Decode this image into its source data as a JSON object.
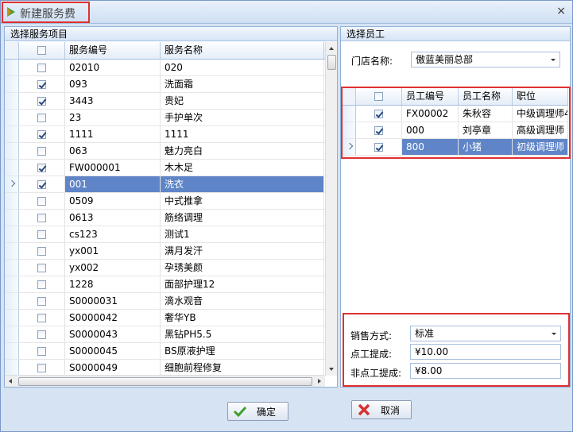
{
  "window": {
    "title": "新建服务费",
    "close_glyph": "×"
  },
  "left": {
    "header": "选择服务项目",
    "columns": [
      "服务编号",
      "服务名称"
    ],
    "rows": [
      {
        "code": "02010",
        "name": "020",
        "checked": false,
        "selected": false
      },
      {
        "code": "093",
        "name": "洗面霜",
        "checked": true,
        "selected": false
      },
      {
        "code": "3443",
        "name": "贵妃",
        "checked": true,
        "selected": false
      },
      {
        "code": "23",
        "name": "手护单次",
        "checked": false,
        "selected": false
      },
      {
        "code": "1111",
        "name": "1111",
        "checked": true,
        "selected": false
      },
      {
        "code": "063",
        "name": "魅力亮白",
        "checked": false,
        "selected": false
      },
      {
        "code": "FW000001",
        "name": "木木足",
        "checked": true,
        "selected": false
      },
      {
        "code": "001",
        "name": "洗衣",
        "checked": true,
        "selected": true
      },
      {
        "code": "0509",
        "name": "中式推拿",
        "checked": false,
        "selected": false
      },
      {
        "code": "0613",
        "name": "筋络调理",
        "checked": false,
        "selected": false
      },
      {
        "code": "cs123",
        "name": "测试1",
        "checked": false,
        "selected": false
      },
      {
        "code": "yx001",
        "name": "满月发汗",
        "checked": false,
        "selected": false
      },
      {
        "code": "yx002",
        "name": "孕琇美颜",
        "checked": false,
        "selected": false
      },
      {
        "code": "1228",
        "name": "面部护理12",
        "checked": false,
        "selected": false
      },
      {
        "code": "S0000031",
        "name": "滴水观音",
        "checked": false,
        "selected": false
      },
      {
        "code": "S0000042",
        "name": "奢华YB",
        "checked": false,
        "selected": false
      },
      {
        "code": "S0000043",
        "name": "黑钻PH5.5",
        "checked": false,
        "selected": false
      },
      {
        "code": "S0000045",
        "name": "BS原液护理",
        "checked": false,
        "selected": false
      },
      {
        "code": "S0000049",
        "name": "细胞前程修复",
        "checked": false,
        "selected": false
      }
    ]
  },
  "right": {
    "header": "选择员工",
    "store_label": "门店名称:",
    "store_value": "傲蓝美丽总部",
    "columns": [
      "员工编号",
      "员工名称",
      "职位"
    ],
    "rows": [
      {
        "code": "FX00002",
        "name": "朱秋容",
        "title": "中级调理师4",
        "checked": true,
        "selected": false
      },
      {
        "code": "000",
        "name": "刘亭章",
        "title": "高级调理师",
        "checked": true,
        "selected": false
      },
      {
        "code": "800",
        "name": "小猪",
        "title": "初级调理师",
        "checked": true,
        "selected": true
      }
    ],
    "sale_label": "销售方式:",
    "sale_value": "标准",
    "point_label": "点工提成:",
    "point_value": "¥10.00",
    "nonpoint_label": "非点工提成:",
    "nonpoint_value": "¥8.00"
  },
  "buttons": {
    "ok": "确定",
    "cancel": "取消"
  },
  "colors": {
    "selection": "#5f85c8",
    "highlight_border": "#e03030"
  }
}
